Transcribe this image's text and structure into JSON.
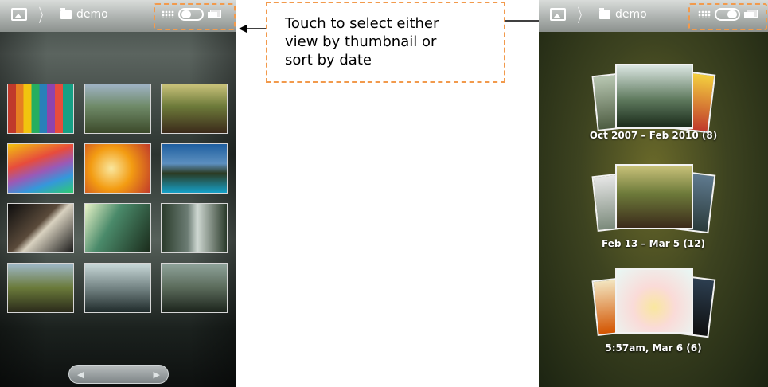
{
  "left_screen": {
    "breadcrumb": {
      "folder_label": "demo"
    },
    "view_toggle": {
      "state": "thumbnail"
    },
    "thumbnails": [
      {
        "name": "thumb-color-bars"
      },
      {
        "name": "thumb-mountains"
      },
      {
        "name": "thumb-field"
      },
      {
        "name": "thumb-rainbow-wave"
      },
      {
        "name": "thumb-flowers"
      },
      {
        "name": "thumb-lake"
      },
      {
        "name": "thumb-tunnel"
      },
      {
        "name": "thumb-alley"
      },
      {
        "name": "thumb-waterfall"
      },
      {
        "name": "thumb-lamp"
      },
      {
        "name": "thumb-trees"
      },
      {
        "name": "thumb-forest"
      }
    ],
    "scrollbar": {
      "left_arrow": "◀",
      "right_arrow": "▶"
    }
  },
  "right_screen": {
    "breadcrumb": {
      "folder_label": "demo"
    },
    "view_toggle": {
      "state": "date"
    },
    "stacks": [
      {
        "label": "Oct 2007 – Feb 2010  (8)"
      },
      {
        "label": "Feb 13 – Mar 5  (12)"
      },
      {
        "label": "5:57am, Mar 6  (6)"
      }
    ]
  },
  "callout": {
    "text": "Touch to select either\nview by thumbnail or\nsort by date"
  },
  "colors": {
    "highlight": "#f29a4c",
    "arrow": "#000000"
  },
  "icons": [
    "gallery-icon",
    "folder-icon",
    "grid-icon",
    "stack-icon"
  ]
}
